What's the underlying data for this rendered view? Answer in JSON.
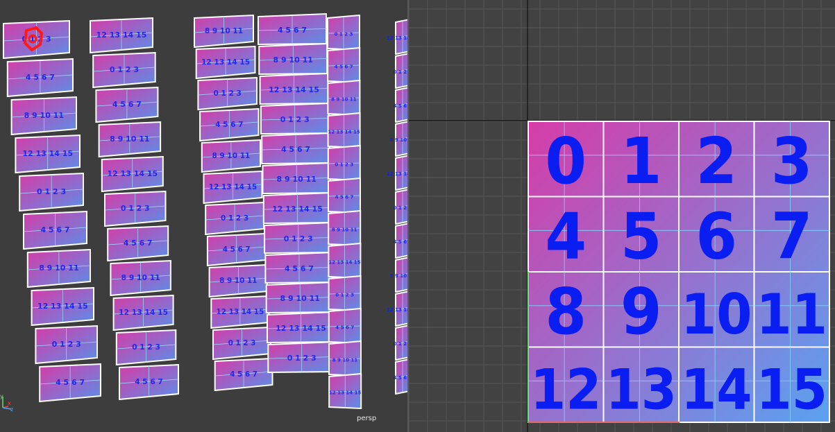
{
  "left_viewport": {
    "camera_label": "persp",
    "axis_labels": {
      "y": "y",
      "x": "x",
      "z": "z"
    }
  },
  "right_viewport": {
    "tile_numbers": [
      "0",
      "1",
      "2",
      "3",
      "4",
      "5",
      "6",
      "7",
      "8",
      "9",
      "10",
      "11",
      "12",
      "13",
      "14",
      "15"
    ]
  },
  "colors": {
    "tile_gradient_start": "#d63ca8",
    "tile_gradient_end": "#5aa2f0",
    "digit_color": "#0a1ef2",
    "grid_line": "#555555",
    "selection_marker": "#ff1a1a"
  }
}
